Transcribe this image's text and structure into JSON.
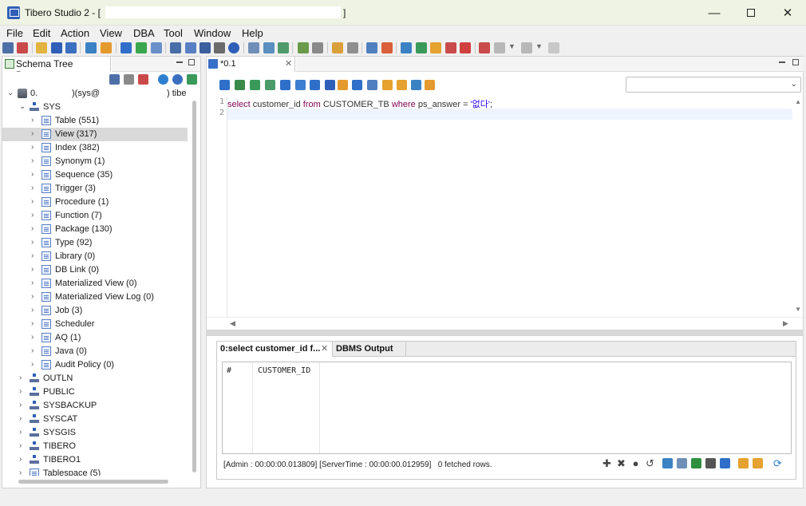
{
  "window": {
    "title": "Tibero Studio 2 - [",
    "title_end": "]",
    "controls": [
      "minimize-icon",
      "maximize-icon",
      "close-icon"
    ]
  },
  "menu": [
    "File",
    "Edit",
    "Action",
    "View",
    "DBA",
    "Tool",
    "Window",
    "Help"
  ],
  "left_panel": {
    "tab_label": "Schema Tree Browser",
    "connection_prefix": "0.",
    "connection_mid": ")(sys@",
    "connection_suffix": ") tibe",
    "schema_sys": "SYS",
    "children": [
      {
        "label": "Table (551)"
      },
      {
        "label": "View (317)",
        "selected": true
      },
      {
        "label": "Index (382)"
      },
      {
        "label": "Synonym (1)"
      },
      {
        "label": "Sequence (35)"
      },
      {
        "label": "Trigger (3)"
      },
      {
        "label": "Procedure (1)"
      },
      {
        "label": "Function (7)"
      },
      {
        "label": "Package (130)"
      },
      {
        "label": "Type (92)"
      },
      {
        "label": "Library (0)"
      },
      {
        "label": "DB Link (0)"
      },
      {
        "label": "Materialized View (0)"
      },
      {
        "label": "Materialized View Log (0)"
      },
      {
        "label": "Job (3)"
      },
      {
        "label": "Scheduler"
      },
      {
        "label": "AQ (1)"
      },
      {
        "label": "Java (0)"
      },
      {
        "label": "Audit Policy (0)"
      }
    ],
    "schemas": [
      "OUTLN",
      "PUBLIC",
      "SYSBACKUP",
      "SYSCAT",
      "SYSGIS",
      "TIBERO",
      "TIBERO1"
    ],
    "tablespace": "Tablespace (5)"
  },
  "editor": {
    "tab_label": "*0.1 ;",
    "line_numbers": [
      "1",
      "2"
    ],
    "code": {
      "kw1": "select",
      "col": " customer_id ",
      "kw2": "from",
      "tbl": " CUSTOMER_TB ",
      "kw3": "where",
      "cond": " ps_answer = ",
      "str": "'없다'",
      "end": ";"
    }
  },
  "results": {
    "tab_active": "0:select customer_id f...",
    "tab_inactive": "DBMS Output",
    "columns": [
      "#",
      "CUSTOMER_ID"
    ],
    "status": "[Admin : 00:00:00.013809] [ServerTime : 00:00:00.012959]   0 fetched rows."
  }
}
